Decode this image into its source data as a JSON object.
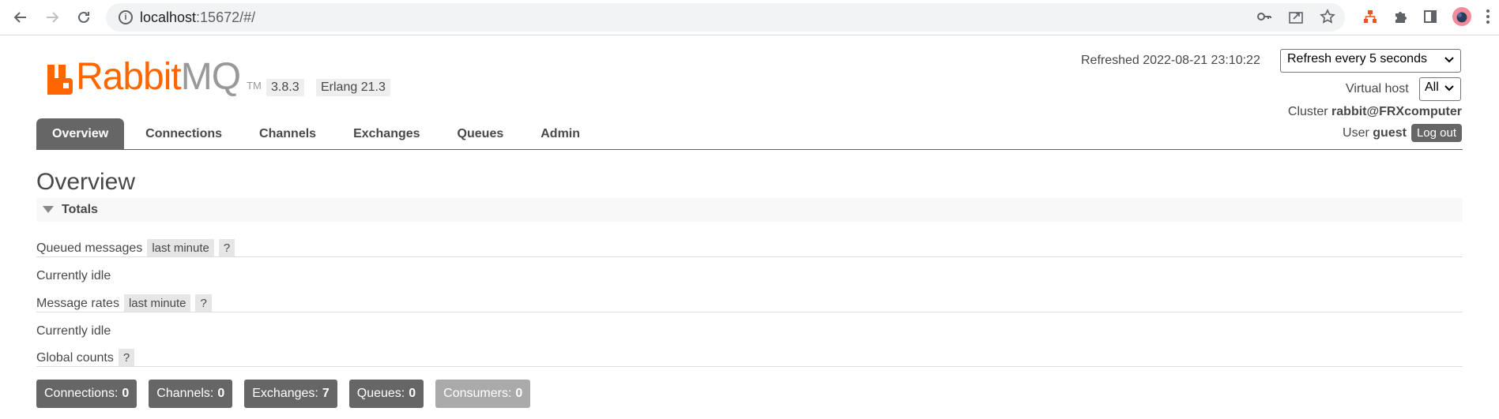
{
  "browser": {
    "url_host": "localhost",
    "url_path": ":15672/#/"
  },
  "logo": {
    "word1": "Rabbit",
    "word2": "MQ",
    "tm": "TM"
  },
  "versions": {
    "rabbitmq": "3.8.3",
    "erlang": "Erlang 21.3"
  },
  "header": {
    "refreshed_label": "Refreshed 2022-08-21 23:10:22",
    "refresh_option": "Refresh every 5 seconds",
    "vhost_label": "Virtual host",
    "vhost_option": "All",
    "cluster_label": "Cluster",
    "cluster_name": "rabbit@FRXcomputer",
    "user_label": "User",
    "user_name": "guest",
    "logout_label": "Log out"
  },
  "tabs": [
    {
      "label": "Overview",
      "active": true
    },
    {
      "label": "Connections"
    },
    {
      "label": "Channels"
    },
    {
      "label": "Exchanges"
    },
    {
      "label": "Queues"
    },
    {
      "label": "Admin"
    }
  ],
  "page_title": "Overview",
  "totals": {
    "section_label": "Totals",
    "queued_label": "Queued messages",
    "queued_range": "last minute",
    "help": "?",
    "queued_status": "Currently idle",
    "rates_label": "Message rates",
    "rates_range": "last minute",
    "rates_status": "Currently idle",
    "global_label": "Global counts"
  },
  "counts": [
    {
      "label": "Connections:",
      "value": "0"
    },
    {
      "label": "Channels:",
      "value": "0"
    },
    {
      "label": "Exchanges:",
      "value": "7"
    },
    {
      "label": "Queues:",
      "value": "0"
    },
    {
      "label": "Consumers:",
      "value": "0"
    }
  ],
  "colors": {
    "brand": "#ff6600",
    "tab_active": "#666666",
    "count_dim": "#aaaaaa"
  }
}
